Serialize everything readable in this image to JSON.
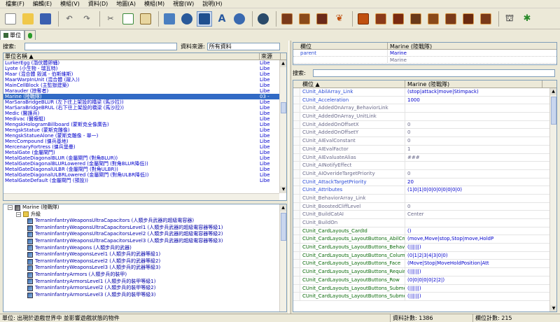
{
  "menu": [
    "檔案(F)",
    "編輯(E)",
    "模組(V)",
    "資料(D)",
    "地圖(A)",
    "模組(M)",
    "視窗(W)",
    "說明(H)"
  ],
  "tabs": {
    "active": "單位"
  },
  "left": {
    "search_label": "搜索:",
    "source_label": "資料來源:",
    "source_value": "所有資料",
    "col_name": "單位名稱",
    "col_source": "來源",
    "rows": [
      {
        "name": "LurkerEgg (潛伏體卵蛹)",
        "source": "Libe"
      },
      {
        "name": "Lyote (小生物 - 瑞瓦特)",
        "source": "Libe"
      },
      {
        "name": "Maar (混合體 毀滅 - 伯斯維斯)",
        "source": "Libe"
      },
      {
        "name": "MaarWarpInUnit (混合體 (躍入))",
        "source": "Libe"
      },
      {
        "name": "MainCellBlock (主監獄建築)",
        "source": "Libe"
      },
      {
        "name": "Marauder (掠奪者)",
        "source": "Libe"
      },
      {
        "name": "Marine (陸戰隊)",
        "source": "03 -"
      },
      {
        "name": "MarSaraBridgeBLUR (左下往上架設的橋梁 (馬沙拉))",
        "source": "Libe"
      },
      {
        "name": "MarSaraBridgeBRUL (右下往上架設的橋梁 (馬沙拉))",
        "source": "Libe"
      },
      {
        "name": "Medic (醫護兵)",
        "source": "Libe"
      },
      {
        "name": "Medivac (醫療艇)",
        "source": "Libe"
      },
      {
        "name": "MengskHologramBillboard (蒙斯克全像廣告)",
        "source": "Libe"
      },
      {
        "name": "MengskStatue (蒙斯克雕像)",
        "source": "Libe"
      },
      {
        "name": "MengskStatueAlone (蒙斯克雕像 - 單一)",
        "source": "Libe"
      },
      {
        "name": "MercCompound (傭兵基地)",
        "source": "Libe"
      },
      {
        "name": "MercenaryFortress (傭兵堡壘)",
        "source": "Libe"
      },
      {
        "name": "MetalGate (金屬閘門)",
        "source": "Libe"
      },
      {
        "name": "MetalGateDiagonalBLUR (金屬閘門 (對角BLUR))",
        "source": "Libe"
      },
      {
        "name": "MetalGateDiagonalBLURLowered (金屬閘門 (對角BLUR降低))",
        "source": "Libe"
      },
      {
        "name": "MetalGateDiagonalULBR (金屬閘門 (對角ULBR))",
        "source": "Libe"
      },
      {
        "name": "MetalGateDiagonalULBRLowered (金屬閘門 (對角ULBR降低))",
        "source": "Libe"
      },
      {
        "name": "MetalGateDefault (金屬閘門 (預設))",
        "source": "Libe"
      }
    ],
    "selected_index": 6
  },
  "tree": {
    "root": "Marine (陸戰隊)",
    "folder": "升級",
    "items": [
      "TerranInfantryWeaponsUltraCapacitors (人類步兵武器的超級電容器)",
      "TerranInfantryWeaponsUltraCapacitorsLevel1 (人類步兵武器的超級電容器等級1)",
      "TerranInfantryWeaponsUltraCapacitorsLevel2 (人類步兵武器的超級電容器等級2)",
      "TerranInfantryWeaponsUltraCapacitorsLevel3 (人類步兵武器的超級電容器等級3)",
      "TerranInfantryWeapons (人類步兵的武器)",
      "TerranInfantryWeaponsLevel1 (人類步兵的武器等級1)",
      "TerranInfantryWeaponsLevel2 (人類步兵的武器等級2)",
      "TerranInfantryWeaponsLevel3 (人類步兵的武器等級3)",
      "TerranInfantryArmors (人類步兵的裝甲)",
      "TerranInfantryArmorsLevel1 (人類步兵的裝甲等級1)",
      "TerranInfantryArmorsLevel2 (人類步兵的裝甲等級2)",
      "TerranInfantryArmorsLevel3 (人類步兵的裝甲等級3)"
    ]
  },
  "right_top": {
    "col_fields": "欄位",
    "col_value": "Marine (陸戰隊)",
    "rows": [
      {
        "field": "parent",
        "value": "Marine"
      },
      {
        "field": "",
        "value": "Marine"
      }
    ]
  },
  "right_search_label": "搜索:",
  "grid": {
    "col_field": "欄位",
    "col_value": "Marine (陸戰隊)",
    "rows": [
      {
        "field": "CUnit_AbilArray_Link",
        "value": "(stop|attack|move|Stimpack)",
        "style": "blue"
      },
      {
        "field": "CUnit_Acceleration",
        "value": "1000",
        "style": "blue"
      },
      {
        "field": "CUnit_AddedOnArray_BehaviorLink",
        "value": "",
        "style": "dim"
      },
      {
        "field": "CUnit_AddedOnArray_UnitLink",
        "value": "",
        "style": "dim"
      },
      {
        "field": "CUnit_AddedOnOffsetX",
        "value": "0",
        "style": "dim"
      },
      {
        "field": "CUnit_AddedOnOffsetY",
        "value": "0",
        "style": "dim"
      },
      {
        "field": "CUnit_AIEvalConstant",
        "value": "0",
        "style": "dim"
      },
      {
        "field": "CUnit_AIEvalFactor",
        "value": "1",
        "style": "dim"
      },
      {
        "field": "CUnit_AIEvaluateAlias",
        "value": "###",
        "style": "dim"
      },
      {
        "field": "CUnit_AINotifyEffect",
        "value": "",
        "style": "dim"
      },
      {
        "field": "CUnit_AIOverideTargetPriority",
        "value": "0",
        "style": "dim"
      },
      {
        "field": "CUnit_AttackTargetPriority",
        "value": "20",
        "style": "blue"
      },
      {
        "field": "CUnit_Attributes",
        "value": "(1|0|1|0|0|0|0|0|0|0|0)",
        "style": "blue"
      },
      {
        "field": "CUnit_BehaviorArray_Link",
        "value": "",
        "style": "dim"
      },
      {
        "field": "CUnit_BoostedCliffLevel",
        "value": "0",
        "style": "dim"
      },
      {
        "field": "CUnit_BuildCatAI",
        "value": "Center",
        "style": "dim"
      },
      {
        "field": "CUnit_BuildOn",
        "value": "",
        "style": "dim"
      },
      {
        "field": "CUnit_CardLayouts_CardId",
        "value": "()",
        "style": "green"
      },
      {
        "field": "CUnit_CardLayouts_LayoutButtons_AbilCmd",
        "value": "(move,Move|stop,Stop|move,HoldP",
        "style": "green"
      },
      {
        "field": "CUnit_CardLayouts_LayoutButtons_Behavior",
        "value": "(||||||)",
        "style": "green"
      },
      {
        "field": "CUnit_CardLayouts_LayoutButtons_Column",
        "value": "(0|1|2|3|4|3|0|0)",
        "style": "green"
      },
      {
        "field": "CUnit_CardLayouts_LayoutButtons_Face",
        "value": "(Move|Stop|MoveHoldPosition|Att",
        "style": "green"
      },
      {
        "field": "CUnit_CardLayouts_LayoutButtons_Requirements",
        "value": "(||||||)",
        "style": "green"
      },
      {
        "field": "CUnit_CardLayouts_LayoutButtons_Row",
        "value": "(0|0|0|0|0|2|2|)",
        "style": "green"
      },
      {
        "field": "CUnit_CardLayouts_LayoutButtons_SubmenuCardId",
        "value": "(||||||)",
        "style": "green"
      },
      {
        "field": "CUnit_CardLayouts_LayoutButtons_SubmenuIsSticky",
        "value": "(||||||)",
        "style": "green"
      }
    ]
  },
  "status": {
    "message": "單位: 出現於遊戲世界中 並影響遊戲狀態的物件",
    "data_count": "資料計數: 1386",
    "field_count": "欄位計數: 215"
  },
  "toolbar_icons": [
    "new-file-icon",
    "open-file-icon",
    "save-icon",
    "undo-icon",
    "redo-icon",
    "cut-icon",
    "copy-icon",
    "paste-icon",
    "terrain-icon",
    "unit-icon",
    "data-icon",
    "text-icon",
    "trigger-icon",
    "ai-icon",
    "import-icon",
    "layout-icon",
    "model-icon",
    "actor-icon",
    "effect-icon",
    "behavior-icon",
    "ability-icon",
    "button-icon",
    "upgrade-icon",
    "requirement-icon",
    "weapon-icon",
    "validator-icon",
    "publish-icon",
    "test-icon"
  ]
}
